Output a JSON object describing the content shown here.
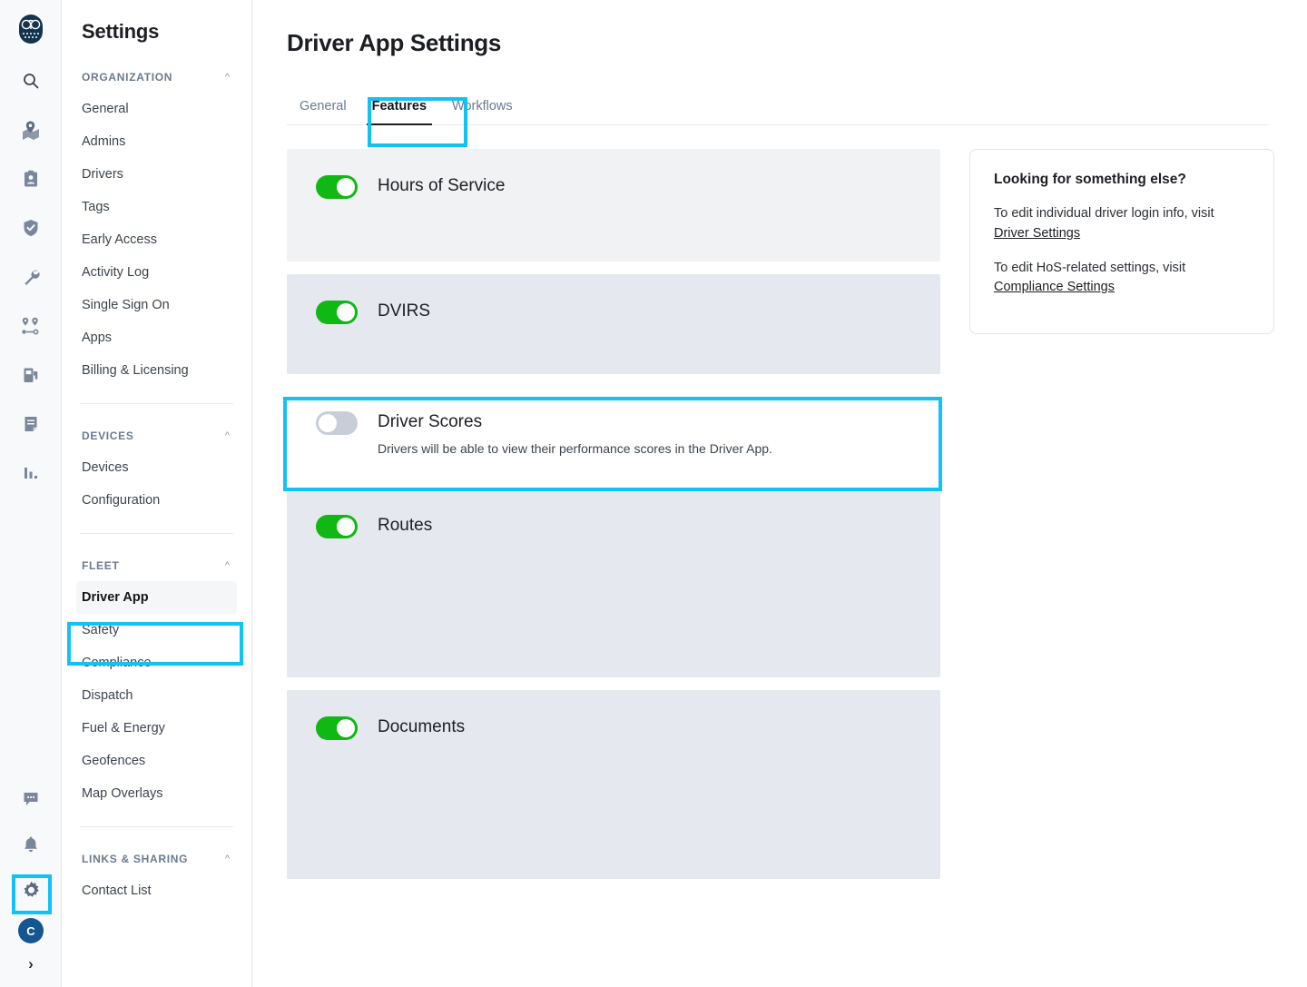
{
  "rail": {
    "logo": "owl-logo",
    "icons": [
      {
        "name": "search-icon",
        "label": "Search"
      },
      {
        "name": "map-pin-icon",
        "label": "Map"
      },
      {
        "name": "id-card-icon",
        "label": "Drivers"
      },
      {
        "name": "shield-check-icon",
        "label": "Safety"
      },
      {
        "name": "wrench-icon",
        "label": "Maintenance"
      },
      {
        "name": "route-icon",
        "label": "Routes"
      },
      {
        "name": "fuel-pump-icon",
        "label": "Fuel"
      },
      {
        "name": "document-icon",
        "label": "Documents"
      },
      {
        "name": "bar-chart-icon",
        "label": "Reports"
      }
    ],
    "bottom_icons": [
      {
        "name": "chat-icon",
        "label": "Messages"
      },
      {
        "name": "bell-icon",
        "label": "Notifications"
      },
      {
        "name": "gear-icon",
        "label": "Settings"
      }
    ],
    "avatar_initial": "C",
    "expand_glyph": "›"
  },
  "nav": {
    "title": "Settings",
    "collapse_glyph": "⌃",
    "sections": [
      {
        "label": "ORGANIZATION",
        "items": [
          "General",
          "Admins",
          "Drivers",
          "Tags",
          "Early Access",
          "Activity Log",
          "Single Sign On",
          "Apps",
          "Billing & Licensing"
        ]
      },
      {
        "label": "DEVICES",
        "items": [
          "Devices",
          "Configuration"
        ]
      },
      {
        "label": "FLEET",
        "items": [
          "Driver App",
          "Safety",
          "Compliance",
          "Dispatch",
          "Fuel & Energy",
          "Geofences",
          "Map Overlays"
        ],
        "active": "Driver App"
      },
      {
        "label": "LINKS & SHARING",
        "items": [
          "Contact List"
        ]
      }
    ]
  },
  "main": {
    "page_title": "Driver App Settings",
    "tabs": [
      {
        "label": "General",
        "active": false
      },
      {
        "label": "Features",
        "active": true
      },
      {
        "label": "Workflows",
        "active": false
      }
    ],
    "features": [
      {
        "name": "hours-of-service",
        "label": "Hours of Service",
        "enabled": true,
        "description": ""
      },
      {
        "name": "dvirs",
        "label": "DVIRS",
        "enabled": true,
        "description": ""
      },
      {
        "name": "driver-scores",
        "label": "Driver Scores",
        "enabled": false,
        "description": "Drivers will be able to view their performance scores in the Driver App."
      },
      {
        "name": "routes",
        "label": "Routes",
        "enabled": true,
        "description": ""
      },
      {
        "name": "documents",
        "label": "Documents",
        "enabled": true,
        "description": ""
      }
    ],
    "info_panel": {
      "title": "Looking for something else?",
      "line1_text": "To edit individual driver login info, visit ",
      "line1_link": "Driver Settings",
      "line2_text": "To edit HoS-related settings, visit ",
      "line2_link": "Compliance Settings"
    }
  },
  "colors": {
    "highlight": "#11C2F5",
    "toggle_on": "#0fb812",
    "toggle_off": "#c8ced8",
    "avatar_bg": "#14568f"
  }
}
